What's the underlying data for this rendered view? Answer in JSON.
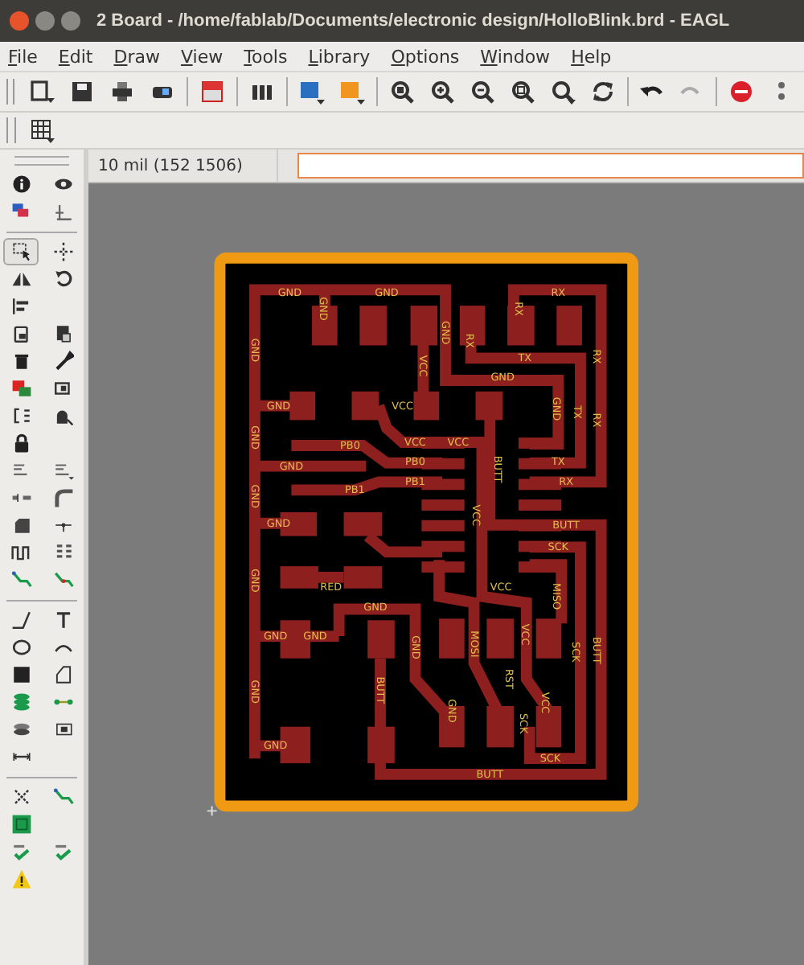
{
  "window": {
    "title": "2 Board - /home/fablab/Documents/electronic design/HolloBlink.brd - EAGL"
  },
  "menu": [
    "File",
    "Edit",
    "Draw",
    "View",
    "Tools",
    "Library",
    "Options",
    "Window",
    "Help"
  ],
  "command_bar": {
    "grid_readout": "10 mil (152 1506)"
  },
  "tools": [
    {
      "selected": false
    },
    {
      "selected": false
    },
    {
      "selected": false
    },
    {
      "selected": false
    },
    {
      "selected": true
    },
    {
      "selected": false
    },
    {
      "selected": false
    },
    {
      "selected": false
    },
    {
      "selected": false
    },
    {
      "selected": false
    },
    {
      "selected": false
    },
    {
      "selected": false
    },
    {
      "selected": false
    },
    {
      "selected": false
    },
    {
      "selected": false
    },
    {
      "selected": false
    },
    {
      "selected": false
    },
    {
      "selected": false
    },
    {
      "selected": false
    },
    {
      "selected": false
    },
    {
      "selected": false
    },
    {
      "selected": false
    },
    {
      "selected": false
    },
    {
      "selected": false
    },
    {
      "selected": false
    },
    {
      "selected": false
    },
    {
      "selected": false
    },
    {
      "selected": false
    },
    {
      "selected": false
    },
    {
      "selected": false
    },
    {
      "selected": false
    },
    {
      "selected": false
    },
    {
      "selected": false
    },
    {
      "selected": false
    },
    {
      "selected": false
    },
    {
      "selected": false
    },
    {
      "selected": false
    },
    {
      "selected": false
    },
    {
      "selected": false
    },
    {
      "selected": false
    },
    {
      "selected": false
    },
    {
      "selected": false
    },
    {
      "selected": false
    },
    {
      "selected": false
    },
    {
      "selected": false
    }
  ],
  "board": {
    "net_labels": [
      "GND",
      "GND",
      "GND",
      "GND",
      "RX",
      "RX",
      "RX",
      "RX",
      "TX",
      "GND",
      "VCC",
      "GND",
      "GND",
      "VCC",
      "GND",
      "TX",
      "RX",
      "GND",
      "PB0",
      "VCC",
      "VCC",
      "PB0",
      "GND",
      "PB1",
      "PB1",
      "TX",
      "RX",
      "BUTT",
      "GND",
      "VCC",
      "GND",
      "BUTT",
      "SCK",
      "RED",
      "MISO",
      "VCC",
      "GND",
      "GND",
      "GND",
      "GND",
      "GND",
      "MOSI",
      "VCC",
      "SCK",
      "BUTT",
      "RST",
      "BUTT",
      "GND",
      "GND",
      "SCK",
      "VCC",
      "GND",
      "SCK",
      "BUTT"
    ]
  }
}
